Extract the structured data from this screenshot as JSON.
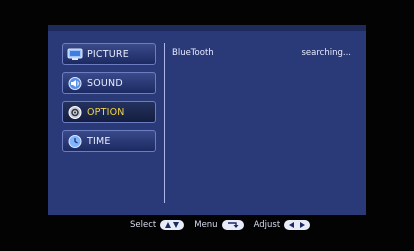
{
  "menu": {
    "items": [
      {
        "label": "PICTURE",
        "icon": "picture-icon",
        "selected": false
      },
      {
        "label": "SOUND",
        "icon": "sound-icon",
        "selected": false
      },
      {
        "label": "OPTION",
        "icon": "option-icon",
        "selected": true
      },
      {
        "label": "TIME",
        "icon": "time-icon",
        "selected": false
      }
    ]
  },
  "content": {
    "setting_label": "BlueTooth",
    "setting_value": "searching..."
  },
  "footer": {
    "select_label": "Select",
    "menu_label": "Menu",
    "adjust_label": "Adjust",
    "select_key_icon": "up-down-arrows-icon",
    "menu_key_icon": "return-arrow-icon",
    "adjust_key_icon": "left-right-arrows-icon"
  },
  "colors": {
    "panel": "#2a3a78",
    "selected_text": "#f3d64a",
    "text": "#e8ecff"
  }
}
